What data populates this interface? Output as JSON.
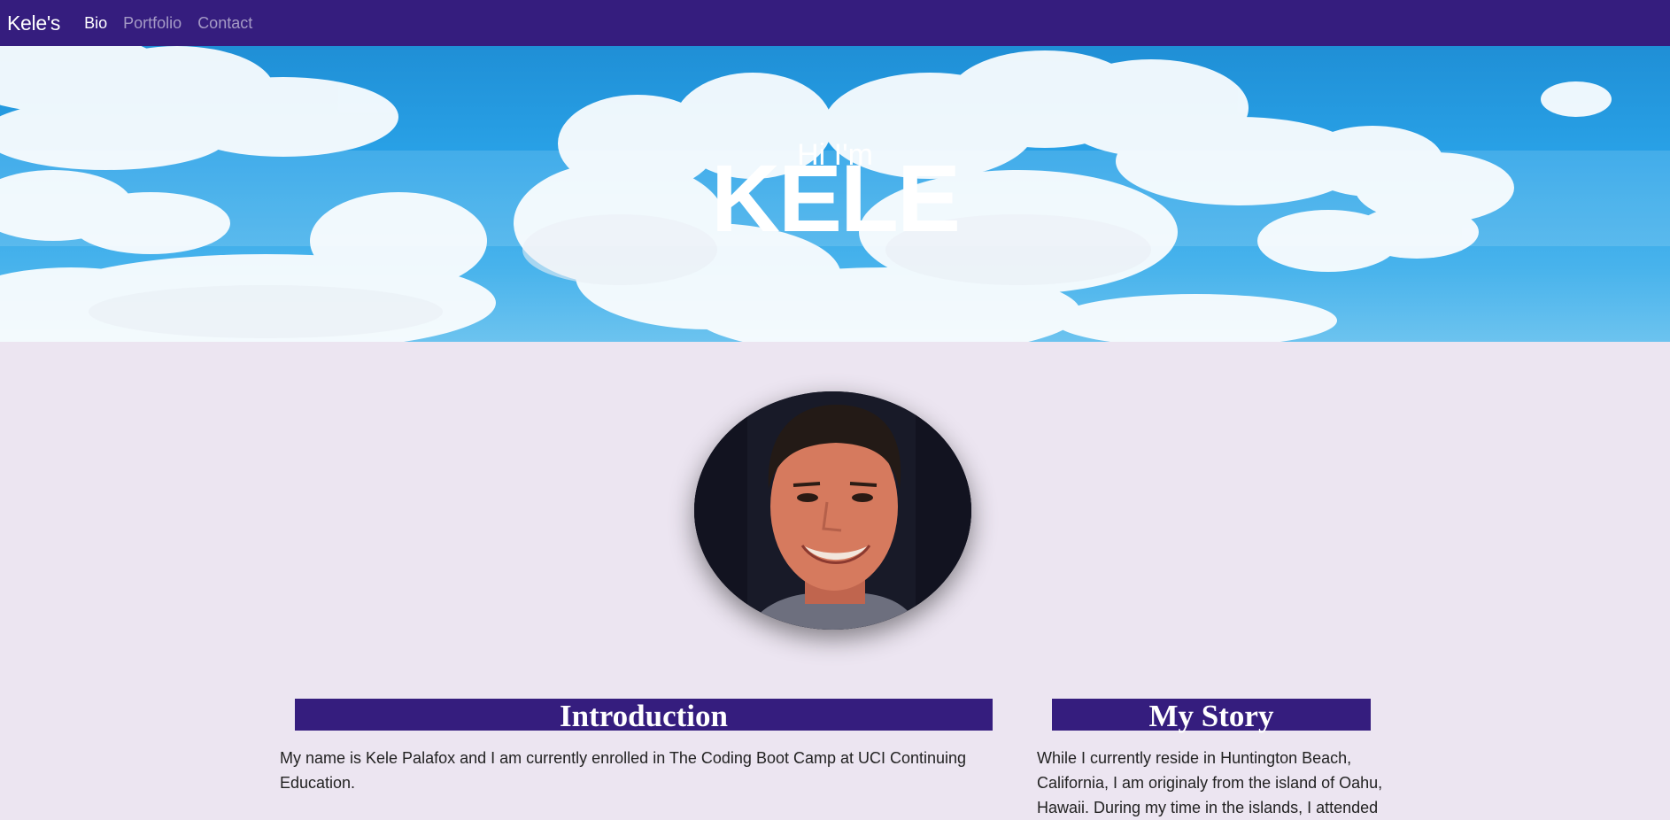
{
  "nav": {
    "brand": "Kele's",
    "links": [
      {
        "label": "Bio",
        "active": true
      },
      {
        "label": "Portfolio",
        "active": false
      },
      {
        "label": "Contact",
        "active": false
      }
    ]
  },
  "hero": {
    "subtitle": "Hi I'm",
    "title": "KELE"
  },
  "sections": {
    "introduction": {
      "heading": "Introduction",
      "text": "My name is Kele Palafox and I am currently enrolled in The Coding Boot Camp at UCI Continuing Education."
    },
    "story": {
      "heading": "My Story",
      "text": "While I currently reside in Huntington Beach, California, I am originaly from the island of Oahu, Hawaii. During my time in the islands, I attended"
    }
  },
  "colors": {
    "navbar": "#351d7e",
    "page_background": "#ece5f1",
    "heading_background": "#351d7e"
  },
  "icons": {
    "avatar": "profile-photo"
  }
}
